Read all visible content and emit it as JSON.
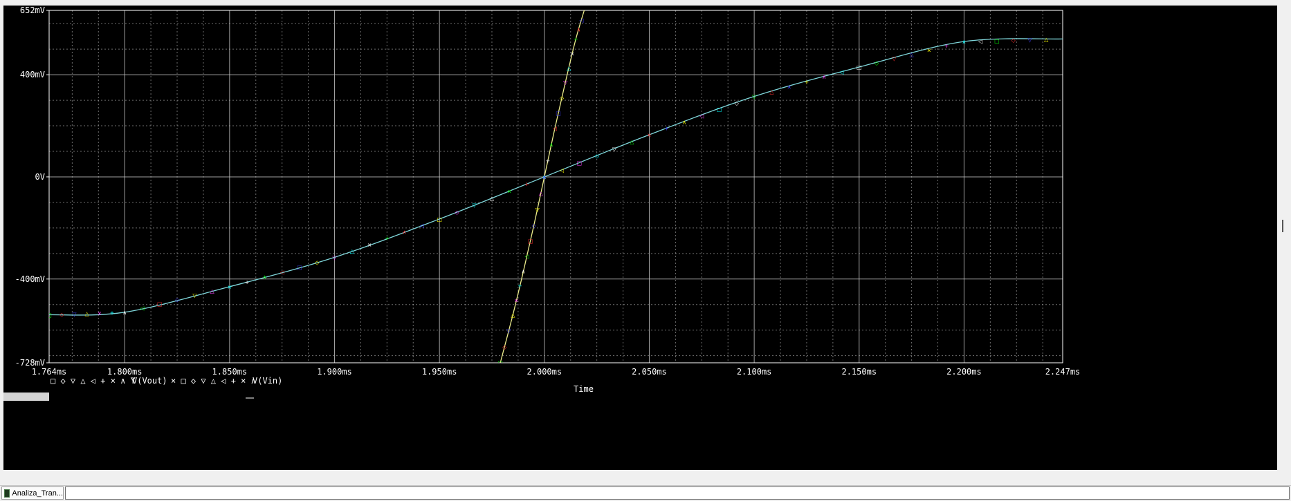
{
  "colors": {
    "background": "#000000",
    "grid": "#c8c8c8",
    "vout": "#ecec8c",
    "vin": "#7fd6da",
    "markers": [
      "#00ff00",
      "#ff3030",
      "#4040ff",
      "#ffff00",
      "#ff40ff",
      "#00ffff",
      "#ffffff"
    ]
  },
  "chart_data": {
    "type": "line",
    "xlabel": "Time",
    "ylabel": "",
    "xlim": [
      1.764,
      2.247
    ],
    "ylim": [
      -728,
      652
    ],
    "x_unit": "ms",
    "y_unit": "mV",
    "grid": true,
    "x_ticks": [
      "1.764ms",
      "1.800ms",
      "1.850ms",
      "1.900ms",
      "1.950ms",
      "2.000ms",
      "2.050ms",
      "2.100ms",
      "2.150ms",
      "2.200ms",
      "2.247ms"
    ],
    "y_ticks": [
      "652mV",
      "400mV",
      "0V",
      "-400mV",
      "-728mV"
    ],
    "series": [
      {
        "name": "V(Vout)",
        "x": [
          1.979,
          1.985,
          1.99,
          1.995,
          2.0,
          2.005,
          2.01,
          2.015,
          2.019
        ],
        "values": [
          -728,
          -540,
          -370,
          -190,
          0,
          190,
          370,
          540,
          652
        ]
      },
      {
        "name": "V(Vin)",
        "x": [
          1.764,
          1.8,
          1.85,
          1.9,
          1.95,
          2.0,
          2.05,
          2.1,
          2.15,
          2.2,
          2.247
        ],
        "values": [
          -540,
          -530,
          -430,
          -315,
          -165,
          0,
          165,
          315,
          430,
          530,
          540
        ]
      }
    ],
    "legend": [
      {
        "markers": "□ ◇ ▽ △ ◁ + × ∧ Y",
        "label": "V(Vout)"
      },
      {
        "markers": "× □ ◇ ▽ △ ◁ + × ∧",
        "label": "V(Vin)"
      }
    ]
  },
  "taskbar": {
    "tab_label": "Analiza_Tran..."
  }
}
